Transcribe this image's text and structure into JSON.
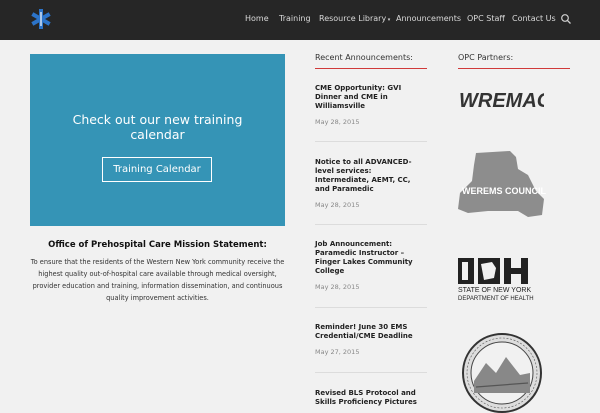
{
  "nav": {
    "items": [
      {
        "label": "Home"
      },
      {
        "label": "Training"
      },
      {
        "label": "Resource Library"
      },
      {
        "label": "Announcements"
      },
      {
        "label": "OPC Staff"
      },
      {
        "label": "Contact Us"
      }
    ]
  },
  "banner": {
    "title_line1": "Check out our new training",
    "title_line2": "calendar",
    "button_label": "Training Calendar",
    "bg_color": "#3594b6"
  },
  "mission": {
    "title": "Office of Prehospital Care Mission Statement:",
    "text": "To ensure that the residents of the Western New York community receive the highest quality out-of-hospital care available through medical oversight, provider education and training, information dissemination, and continuous quality improvement activities."
  },
  "announcements": {
    "heading": "Recent Announcements:",
    "items": [
      {
        "title": "CME Opportunity: GVI Dinner and CME in Williamsville",
        "date": "May 28, 2015"
      },
      {
        "title": "Notice to all ADVANCED-level services: Intermediate, AEMT, CC, and Paramedic",
        "date": "May 28, 2015"
      },
      {
        "title": "Job Announcement: Paramedic Instructor – Finger Lakes Community College",
        "date": "May 28, 2015"
      },
      {
        "title": "Reminder! June 30 EMS Credential/CME Deadline",
        "date": "May 27, 2015"
      },
      {
        "title": "Revised BLS Protocol and Skills Proficiency Pictures",
        "date": ""
      }
    ]
  },
  "partners": {
    "heading": "OPC Partners:",
    "wremac": "WREMAC",
    "werems": "WEREMS COUNCIL",
    "doh_line1": "STATE OF NEW YORK",
    "doh_line2": "DEPARTMENT OF HEALTH",
    "accent_color": "#d03a3a"
  }
}
